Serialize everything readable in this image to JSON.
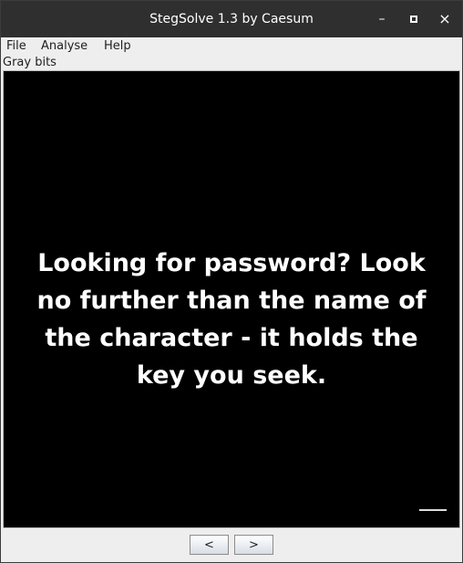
{
  "window": {
    "title": "StegSolve 1.3 by Caesum",
    "controls": {
      "minimize": "–",
      "maximize": "▫",
      "close": "×"
    }
  },
  "menu": {
    "items": [
      "File",
      "Analyse",
      "Help"
    ]
  },
  "plane_label": "Gray bits",
  "image": {
    "caption": "Looking for password? Look no further than the name of the character - it holds the key you seek."
  },
  "nav": {
    "prev_label": "<",
    "next_label": ">"
  },
  "colors": {
    "titlebar": "#2f2f2f",
    "window": "#eeeeee",
    "canvas": "#000000",
    "caption": "#ffffff"
  }
}
